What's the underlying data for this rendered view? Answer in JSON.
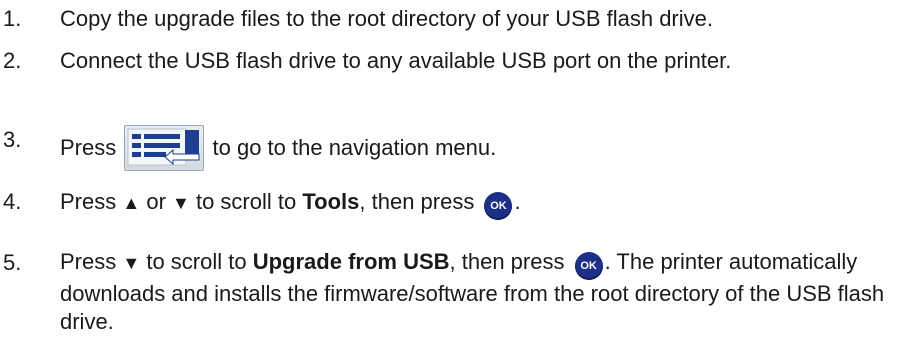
{
  "steps": [
    {
      "num": "1.",
      "text": "Copy the upgrade files to the root directory of your USB flash drive."
    },
    {
      "num": "2.",
      "text": "Connect the USB flash drive to any available USB port on the printer."
    },
    {
      "num": "3.",
      "before": "Press",
      "icon": "navigation-menu-icon",
      "after": "to go to the navigation menu."
    },
    {
      "num": "4.",
      "pre": "Press",
      "up": "▲",
      "or": "or",
      "down": "▼",
      "mid": "to scroll to",
      "bold": "Tools",
      "post": ", then press",
      "ok": "OK",
      "end": "."
    },
    {
      "num": "5.",
      "pre": "Press",
      "down": "▼",
      "mid": "to scroll to",
      "bold": "Upgrade from USB",
      "post": ", then press",
      "ok": "OK",
      "end": ". The printer automatically downloads and installs the firmware/software from the root directory of the USB flash drive."
    }
  ],
  "colors": {
    "ok_button": "#1d2f86",
    "nav_icon_blue": "#1e3f8f"
  }
}
